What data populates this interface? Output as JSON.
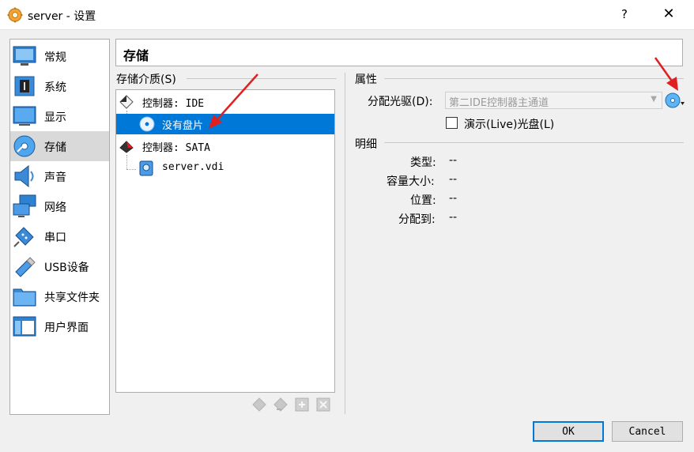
{
  "window": {
    "title": "server - 设置",
    "help_label": "?",
    "close_label": "✕",
    "icon": "gear-icon"
  },
  "sidebar": {
    "items": [
      {
        "label": "常规",
        "icon": "monitor-icon"
      },
      {
        "label": "系统",
        "icon": "chip-icon"
      },
      {
        "label": "显示",
        "icon": "display-icon"
      },
      {
        "label": "存储",
        "icon": "storage-disc-icon",
        "selected": true
      },
      {
        "label": "声音",
        "icon": "speaker-icon"
      },
      {
        "label": "网络",
        "icon": "network-icon"
      },
      {
        "label": "串口",
        "icon": "serial-port-icon"
      },
      {
        "label": "USB设备",
        "icon": "usb-icon"
      },
      {
        "label": "共享文件夹",
        "icon": "folder-icon"
      },
      {
        "label": "用户界面",
        "icon": "window-icon"
      }
    ]
  },
  "page": {
    "title": "存储"
  },
  "storage": {
    "group_label": "存储介质(S)",
    "tree": [
      {
        "label": "控制器: IDE",
        "type": "controller",
        "icon": "ide-controller-icon"
      },
      {
        "label": "没有盘片",
        "type": "optical",
        "icon": "optical-disc-icon",
        "selected": true
      },
      {
        "label": "控制器: SATA",
        "type": "controller",
        "icon": "sata-controller-icon"
      },
      {
        "label": "server.vdi",
        "type": "disk",
        "icon": "hard-disk-icon"
      }
    ]
  },
  "attributes": {
    "group_label": "属性",
    "drive_label": "分配光驱(D):",
    "drive_value": "第二IDE控制器主通道",
    "live_cd_label": "演示(Live)光盘(L)",
    "live_cd_checked": false
  },
  "details": {
    "group_label": "明细",
    "rows": [
      {
        "label": "类型:",
        "value": "--"
      },
      {
        "label": "容量大小:",
        "value": "--"
      },
      {
        "label": "位置:",
        "value": "--"
      },
      {
        "label": "分配到:",
        "value": "--"
      }
    ]
  },
  "buttons": {
    "ok": "OK",
    "cancel": "Cancel"
  },
  "colors": {
    "selection": "#0078d7",
    "annotation_arrow": "#e02020"
  }
}
